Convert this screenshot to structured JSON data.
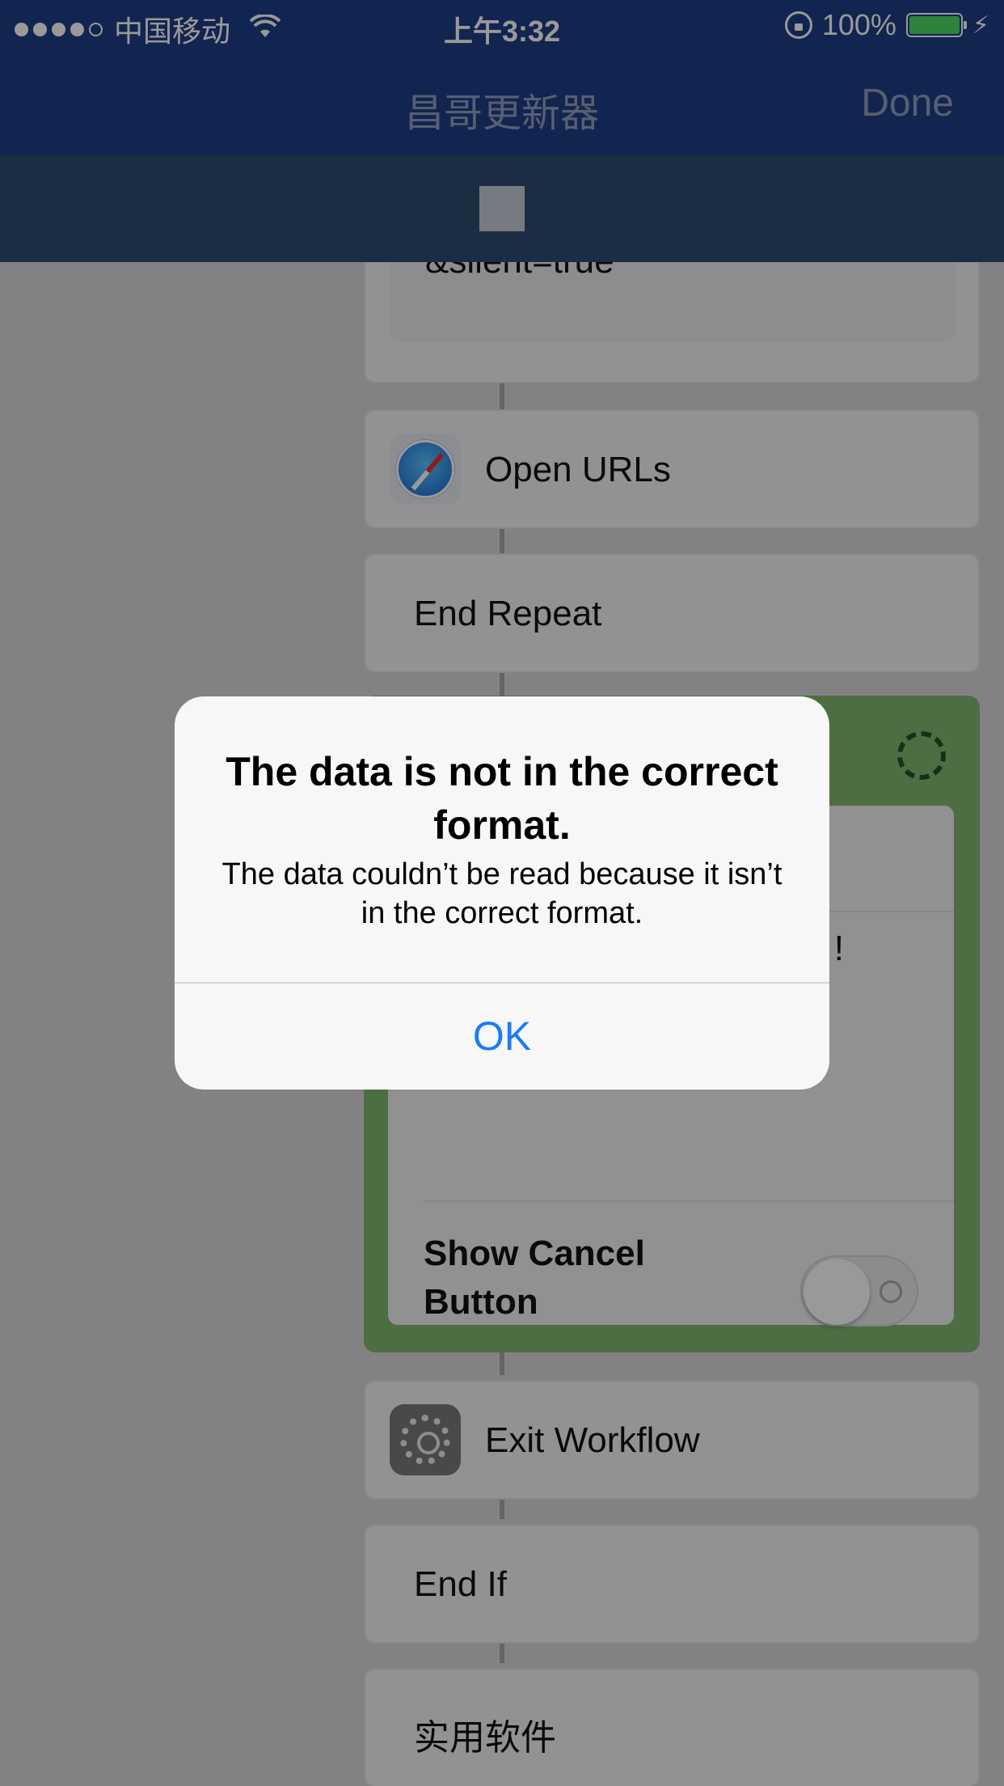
{
  "status_bar": {
    "carrier": "中国移动",
    "time": "上午3:32",
    "battery": "100%",
    "signal_bars_filled": 4,
    "signal_bars_total": 5,
    "battery_level": 1.0,
    "colors": {
      "background": "#1e3f86",
      "battery_fill": "#4cd964"
    }
  },
  "nav": {
    "title": "昌哥更新器",
    "done_label": "Done"
  },
  "workflow": {
    "text_card_value": "&silent=true",
    "open_urls_label": "Open URLs",
    "end_repeat_label": "End Repeat",
    "alert_card_trailing_text": "!",
    "show_cancel_label": "Show Cancel Button",
    "show_cancel_enabled": false,
    "exit_workflow_label": "Exit Workflow",
    "end_if_label": "End If",
    "last_card_label": "实用软件",
    "icons": [
      "safari-icon",
      "gear-icon",
      "spinner-icon"
    ],
    "colors": {
      "alert_action": "#80b870"
    }
  },
  "alert": {
    "title": "The data is not in the correct format.",
    "message": "The data couldn’t be read because it isn’t in the correct format.",
    "ok_label": "OK",
    "colors": {
      "ok_text": "#1a7cf5"
    }
  }
}
